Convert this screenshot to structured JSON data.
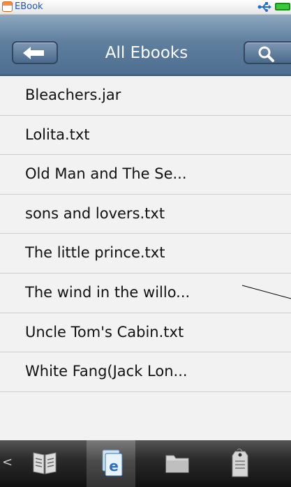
{
  "status_bar": {
    "app_title": "EBook",
    "icons": [
      "ebook-app-icon",
      "usb-icon",
      "battery-icon"
    ]
  },
  "header": {
    "title": "All Ebooks",
    "back_icon": "back-arrow-icon",
    "search_icon": "search-icon"
  },
  "books": [
    "Bleachers.jar",
    "Lolita.txt",
    "Old Man and The Se...",
    "sons and lovers.txt",
    "The little prince.txt",
    "The wind in the willo...",
    "Uncle Tom's Cabin.txt",
    "White Fang(Jack Lon..."
  ],
  "toolbar": {
    "left_arrow": "<",
    "items": [
      "open-book-icon",
      "ebook-library-icon",
      "folder-icon",
      "tags-icon"
    ],
    "active_item": "ebook-library-icon"
  },
  "colors": {
    "header": "#5f7f9f",
    "title_text": "#ffffff",
    "status_title": "#1a54c6",
    "battery": "#39c939",
    "toolbar": "#2b2b2b"
  }
}
